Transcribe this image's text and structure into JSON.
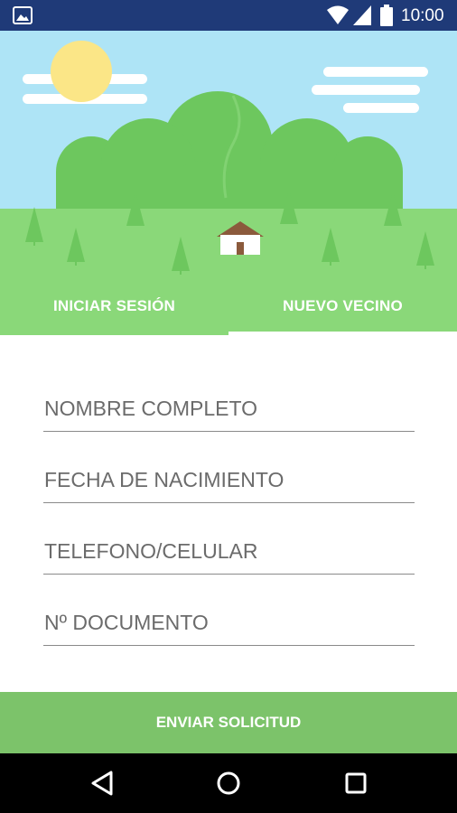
{
  "status_bar": {
    "time": "10:00",
    "icons": [
      "gallery-icon",
      "wifi-icon",
      "signal-icon",
      "battery-icon"
    ],
    "background": "#1f3a78"
  },
  "hero": {
    "illustration": "landscape with sun, clouds, green hills, pine trees and a small house",
    "colors": {
      "sky": "#aee4f6",
      "grass": "#8ad879",
      "hill": "#6dc75e",
      "sun": "#fbe687"
    }
  },
  "tabs": {
    "items": [
      {
        "label": "INICIAR SESIÓN",
        "selected": false
      },
      {
        "label": "NUEVO VECINO",
        "selected": true
      }
    ]
  },
  "form": {
    "fields": [
      {
        "placeholder": "NOMBRE COMPLETO",
        "value": ""
      },
      {
        "placeholder": "FECHA DE NACIMIENTO",
        "value": ""
      },
      {
        "placeholder": "TELEFONO/CELULAR",
        "value": ""
      },
      {
        "placeholder": "Nº DOCUMENTO",
        "value": ""
      }
    ],
    "submit_label": "ENVIAR SOLICITUD",
    "accent": "#7cc36a"
  },
  "nav_bar": {
    "icons": [
      "back-icon",
      "home-icon",
      "recents-icon"
    ]
  }
}
